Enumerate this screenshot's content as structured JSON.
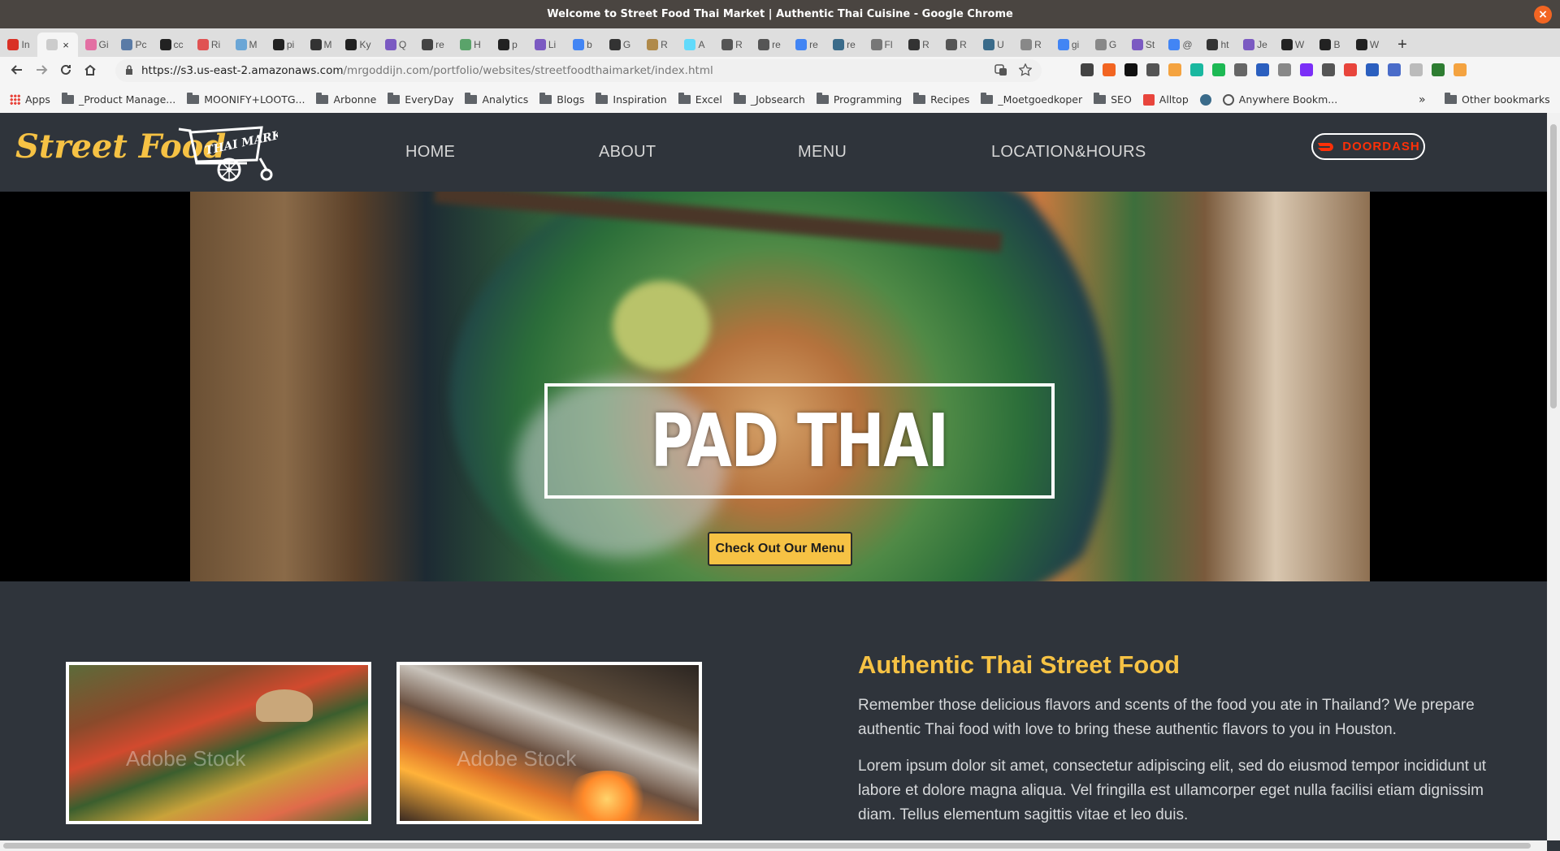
{
  "browser": {
    "window_title": "Welcome to Street Food Thai Market | Authentic Thai Cuisine - Google Chrome",
    "close_glyph": "×",
    "tabs": [
      {
        "label": "In",
        "color": "#d93025"
      },
      {
        "label": "",
        "color": "#cccccc",
        "active": true
      },
      {
        "label": "Gi",
        "color": "#e36fa3"
      },
      {
        "label": "Pc",
        "color": "#5a7ba6"
      },
      {
        "label": "cc",
        "color": "#222222"
      },
      {
        "label": "Ri",
        "color": "#e05353"
      },
      {
        "label": "M",
        "color": "#6ba6d6"
      },
      {
        "label": "pi",
        "color": "#222222"
      },
      {
        "label": "M",
        "color": "#333333"
      },
      {
        "label": "Ky",
        "color": "#222222"
      },
      {
        "label": "Q",
        "color": "#7b5ac2"
      },
      {
        "label": "re",
        "color": "#444444"
      },
      {
        "label": "H",
        "color": "#5aa36a"
      },
      {
        "label": "p",
        "color": "#222222"
      },
      {
        "label": "Li",
        "color": "#7b5ac2"
      },
      {
        "label": "b",
        "color": "#4285f4"
      },
      {
        "label": "G",
        "color": "#333333"
      },
      {
        "label": "R",
        "color": "#b08a4a"
      },
      {
        "label": "A",
        "color": "#61dafb"
      },
      {
        "label": "R",
        "color": "#555555"
      },
      {
        "label": "re",
        "color": "#555555"
      },
      {
        "label": "re",
        "color": "#4285f4"
      },
      {
        "label": "re",
        "color": "#3a6b8a"
      },
      {
        "label": "Fl",
        "color": "#777777"
      },
      {
        "label": "R",
        "color": "#333333"
      },
      {
        "label": "R",
        "color": "#555555"
      },
      {
        "label": "U",
        "color": "#3a6b8a"
      },
      {
        "label": "R",
        "color": "#888888"
      },
      {
        "label": "gi",
        "color": "#4285f4"
      },
      {
        "label": "G",
        "color": "#888888"
      },
      {
        "label": "St",
        "color": "#7b5ac2"
      },
      {
        "label": "@",
        "color": "#4285f4"
      },
      {
        "label": "ht",
        "color": "#333333"
      },
      {
        "label": "Je",
        "color": "#7b5ac2"
      },
      {
        "label": "W",
        "color": "#222222"
      },
      {
        "label": "B",
        "color": "#222222"
      },
      {
        "label": "W",
        "color": "#222222"
      }
    ],
    "new_tab_glyph": "+",
    "close_tab_glyph": "×",
    "url_host": "https://s3.us-east-2.amazonaws.com",
    "url_path": "/mrgoddijn.com/portfolio/websites/streetfoodthaimarket/index.html",
    "extension_colors": [
      "#444444",
      "#f26522",
      "#111111",
      "#555555",
      "#f4a340",
      "#1ab8a0",
      "#1db954",
      "#666666",
      "#2b5fbf",
      "#888888",
      "#7b2ff7",
      "#555555",
      "#e8453c",
      "#2b5fbf",
      "#4a6cc9",
      "#bbbbbb",
      "#2e7d32",
      "#f4a340"
    ],
    "bookmarks": {
      "apps_label": "Apps",
      "items": [
        {
          "label": "_Product Manage...",
          "type": "folder"
        },
        {
          "label": "MOONIFY+LOOTG...",
          "type": "folder"
        },
        {
          "label": "Arbonne",
          "type": "folder"
        },
        {
          "label": "EveryDay",
          "type": "folder"
        },
        {
          "label": "Analytics",
          "type": "folder"
        },
        {
          "label": "Blogs",
          "type": "folder"
        },
        {
          "label": "Inspiration",
          "type": "folder"
        },
        {
          "label": "Excel",
          "type": "folder"
        },
        {
          "label": "_Jobsearch",
          "type": "folder"
        },
        {
          "label": "Programming",
          "type": "folder"
        },
        {
          "label": "Recipes",
          "type": "folder"
        },
        {
          "label": "_Moetgoedkoper",
          "type": "folder"
        },
        {
          "label": "SEO",
          "type": "folder"
        },
        {
          "label": "Alltop",
          "type": "alltop"
        },
        {
          "label": "",
          "type": "star"
        },
        {
          "label": "Anywhere Bookm...",
          "type": "globe"
        }
      ],
      "overflow": "»",
      "other_label": "Other bookmarks"
    }
  },
  "site": {
    "logo_text": "Street Food",
    "logo_cart_text": "THAI MARKET",
    "nav": [
      "HOME",
      "ABOUT",
      "MENU",
      "LOCATION&HOURS"
    ],
    "doordash_label": "DOORDASH",
    "hero_title": "PAD THAI",
    "cta_label": "Check Out Our Menu",
    "watermark": "Adobe Stock",
    "about_title": "Authentic Thai Street Food",
    "about_p1": "Remember those delicious flavors and scents of the food you ate in Thailand? We prepare authentic Thai food with love to bring these authentic flavors to you in Houston.",
    "about_p2": "Lorem ipsum dolor sit amet, consectetur adipiscing elit, sed do eiusmod tempor incididunt ut labore et dolore magna aliqua. Vel fringilla est ullamcorper eget nulla facilisi etiam dignissim diam. Tellus elementum sagittis vitae et leo duis."
  }
}
